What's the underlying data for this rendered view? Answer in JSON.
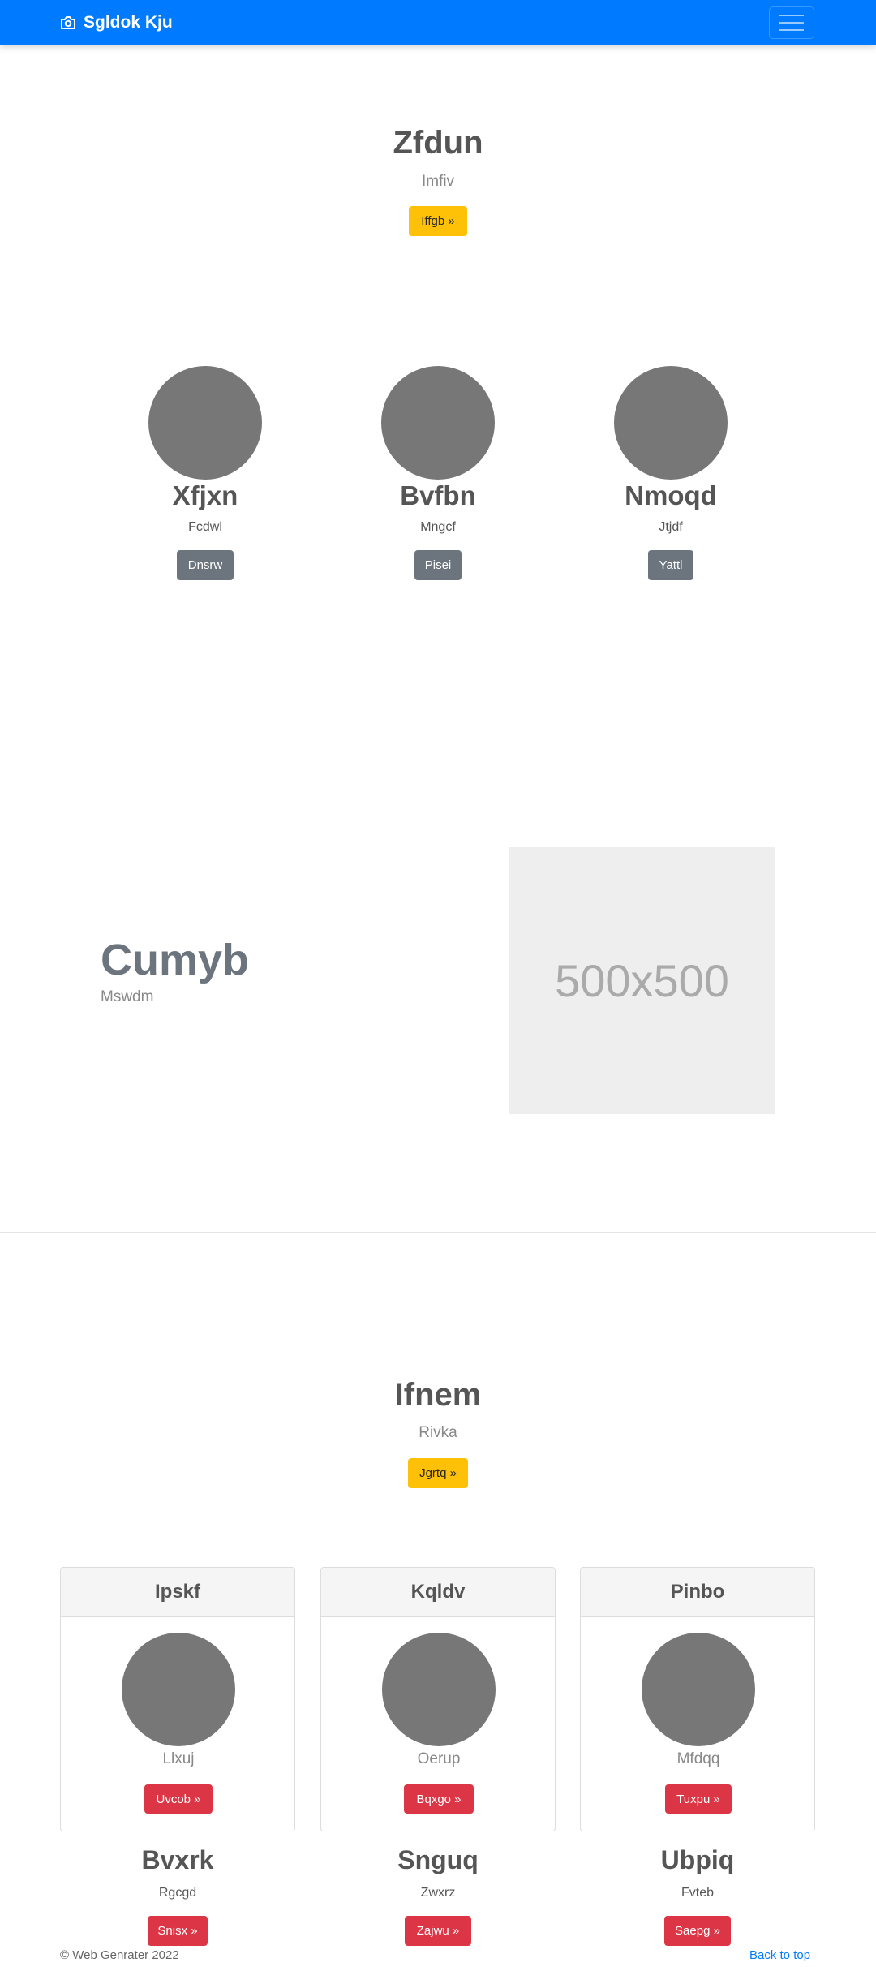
{
  "navbar": {
    "brand": "Sgldok Kju",
    "brand_icon": "camera-icon",
    "toggler_icon": "hamburger-icon",
    "background": "#007bff"
  },
  "hero": {
    "title": "Zfdun",
    "lead": "Imfiv",
    "button": "Iffgb »"
  },
  "profiles": [
    {
      "name": "Xfjxn",
      "text": "Fcdwl",
      "button": "Dnsrw"
    },
    {
      "name": "Bvfbn",
      "text": "Mngcf",
      "button": "Pisei"
    },
    {
      "name": "Nmoqd",
      "text": "Jtjdf",
      "button": "Yattl"
    }
  ],
  "feature": {
    "title": "Cumyb",
    "subtitle": "Mswdm",
    "image_text": "500x500"
  },
  "section2": {
    "title": "Ifnem",
    "lead": "Rivka",
    "button": "Jgrtq »"
  },
  "cards": [
    {
      "header": "Ipskf",
      "text": "Llxuj",
      "button": "Uvcob »"
    },
    {
      "header": "Kqldv",
      "text": "Oerup",
      "button": "Bqxgo »"
    },
    {
      "header": "Pinbo",
      "text": "Mfdqq",
      "button": "Tuxpu »"
    }
  ],
  "items": [
    {
      "title": "Bvxrk",
      "text": "Rgcgd",
      "button": "Snisx »"
    },
    {
      "title": "Snguq",
      "text": "Zwxrz",
      "button": "Zajwu »"
    },
    {
      "title": "Ubpiq",
      "text": "Fvteb",
      "button": "Saepg »"
    }
  ],
  "footer": {
    "copyright": "© Web Genrater 2022",
    "back_to_top": "Back to top"
  }
}
